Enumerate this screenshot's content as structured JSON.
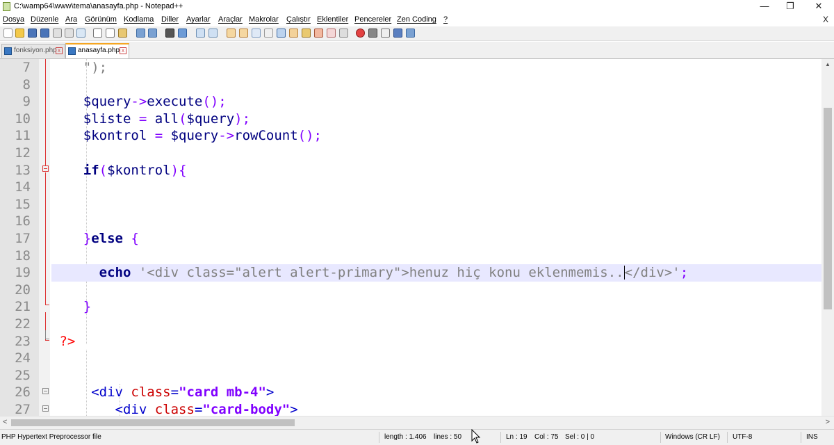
{
  "window": {
    "title": "C:\\wamp64\\www\\tema\\anasayfa.php - Notepad++",
    "minimize_glyph": "—",
    "maximize_glyph": "❐",
    "close_glyph": "✕"
  },
  "menu": {
    "items": [
      "Dosya",
      "Düzenle",
      "Ara",
      "Görünüm",
      "Kodlama",
      "Diller",
      "Ayarlar",
      "Araçlar",
      "Makrolar",
      "Çalıştır",
      "Eklentiler",
      "Pencereler",
      "Zen Coding",
      "?"
    ],
    "close_glyph": "X"
  },
  "tabs": [
    {
      "label": "fonksiyon.php",
      "active": false
    },
    {
      "label": "anasayfa.php",
      "active": true
    }
  ],
  "editor": {
    "current_line": 19,
    "lines": [
      {
        "n": "7"
      },
      {
        "n": "8"
      },
      {
        "n": "9"
      },
      {
        "n": "10"
      },
      {
        "n": "11"
      },
      {
        "n": "12"
      },
      {
        "n": "13"
      },
      {
        "n": "14"
      },
      {
        "n": "15"
      },
      {
        "n": "16"
      },
      {
        "n": "17"
      },
      {
        "n": "18"
      },
      {
        "n": "19"
      },
      {
        "n": "20"
      },
      {
        "n": "21"
      },
      {
        "n": "22"
      },
      {
        "n": "23"
      },
      {
        "n": "24"
      },
      {
        "n": "25"
      },
      {
        "n": "26"
      },
      {
        "n": "27"
      }
    ],
    "tokens": {
      "l7_str": "\");",
      "l9_var": "$query",
      "l9_arrow": "->",
      "l9_fn": "execute",
      "l9_paren": "();",
      "l10_var": "$liste",
      "l10_eq": " = ",
      "l10_fn": "all",
      "l10_p1": "(",
      "l10_arg": "$query",
      "l10_p2": ");",
      "l11_var": "$kontrol",
      "l11_eq": " = ",
      "l11_var2": "$query",
      "l11_arrow": "->",
      "l11_fn": "rowCount",
      "l11_paren": "();",
      "l13_kw": "if",
      "l13_p1": "(",
      "l13_var": "$kontrol",
      "l13_p2": "){",
      "l17_brace": "}",
      "l17_kw": "else",
      "l17_brace2": " {",
      "l19_kw": "echo",
      "l19_str_a": " '<div class=\"alert alert-primary\">henuz hiç konu eklenmemis..",
      "l19_str_b": "</div>'",
      "l19_semi": ";",
      "l21_brace": "}",
      "l23_php": "?>",
      "l26_lt": "<",
      "l26_tag": "div",
      "l26_attr": " class",
      "l26_eq": "=",
      "l26_val": "\"card mb-4\"",
      "l26_gt": ">",
      "l27_lt": "<",
      "l27_tag": "div",
      "l27_attr": " class",
      "l27_eq": "=",
      "l27_val": "\"card-body\"",
      "l27_gt": ">"
    }
  },
  "scroll": {
    "left_glyph": "<",
    "right_glyph": ">",
    "up_glyph": "▲"
  },
  "status": {
    "filetype": "PHP Hypertext Preprocessor file",
    "length": "length : 1.406",
    "lines": "lines : 50",
    "ln": "Ln : 19",
    "col": "Col : 75",
    "sel": "Sel : 0 | 0",
    "eol": "Windows (CR LF)",
    "encoding": "UTF-8",
    "mode": "INS"
  },
  "colors": {
    "current_line_bg": "#e8e8ff",
    "keyword": "#000080",
    "string": "#808080",
    "php_tag": "#ff0000",
    "html_tag": "#0000cc",
    "html_attr": "#cc0000",
    "html_value": "#8000ff",
    "tab_accent": "#f5a623"
  }
}
